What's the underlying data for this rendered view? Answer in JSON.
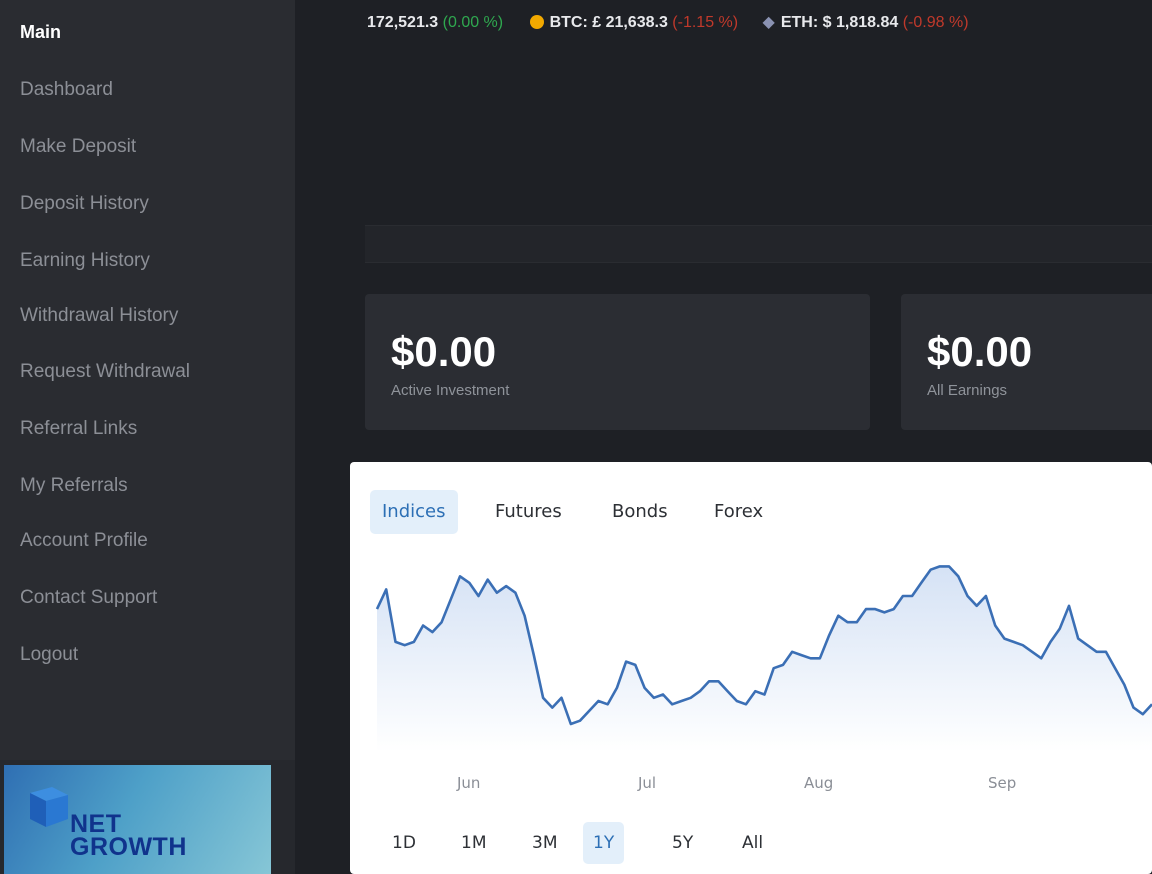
{
  "sidebar": {
    "items": [
      {
        "label": "Main"
      },
      {
        "label": "Dashboard"
      },
      {
        "label": "Make Deposit"
      },
      {
        "label": "Deposit History"
      },
      {
        "label": "Earning History"
      },
      {
        "label": "Withdrawal History"
      },
      {
        "label": "Request Withdrawal"
      },
      {
        "label": "Referral Links"
      },
      {
        "label": "My Referrals"
      },
      {
        "label": "Account Profile"
      },
      {
        "label": "Contact Support"
      },
      {
        "label": "Logout"
      }
    ],
    "logo": {
      "line1": "NET",
      "line2": "GROWTH"
    }
  },
  "ticker": {
    "index_value": "172,521.3",
    "index_change": "(0.00 %)",
    "btc_label": "BTC: £ 21,638.3",
    "btc_change": "(-1.15 %)",
    "eth_label": "ETH: $ 1,818.84",
    "eth_change": "(-0.98 %)"
  },
  "stats": [
    {
      "value": "$0.00",
      "label": "Active Investment"
    },
    {
      "value": "$0.00",
      "label": "All Earnings"
    }
  ],
  "widget": {
    "tabs": [
      {
        "label": "Indices",
        "active": true
      },
      {
        "label": "Futures",
        "active": false
      },
      {
        "label": "Bonds",
        "active": false
      },
      {
        "label": "Forex",
        "active": false
      }
    ],
    "ranges": [
      {
        "label": "1D",
        "active": false
      },
      {
        "label": "1M",
        "active": false
      },
      {
        "label": "3M",
        "active": false
      },
      {
        "label": "1Y",
        "active": true
      },
      {
        "label": "5Y",
        "active": false
      },
      {
        "label": "All",
        "active": false
      }
    ]
  },
  "chart_data": {
    "type": "area",
    "x_tick_labels": [
      "Jun",
      "Jul",
      "Aug",
      "Sep"
    ],
    "y_axis_visible": false,
    "grid": false,
    "line_color": "#3b6fb5",
    "fill_color": "#dce7f6",
    "values": [
      62,
      68,
      52,
      51,
      52,
      57,
      55,
      58,
      65,
      72,
      70,
      66,
      71,
      67,
      69,
      67,
      60,
      48,
      35,
      32,
      35,
      27,
      28,
      31,
      34,
      33,
      38,
      46,
      45,
      38,
      35,
      36,
      33,
      34,
      35,
      37,
      40,
      40,
      37,
      34,
      33,
      37,
      36,
      44,
      45,
      49,
      48,
      47,
      47,
      54,
      60,
      58,
      58,
      62,
      62,
      61,
      62,
      66,
      66,
      70,
      74,
      75,
      75,
      72,
      66,
      63,
      66,
      57,
      53,
      52,
      51,
      49,
      47,
      52,
      56,
      63,
      53,
      51,
      49,
      49,
      44,
      39,
      32,
      30,
      33
    ]
  }
}
